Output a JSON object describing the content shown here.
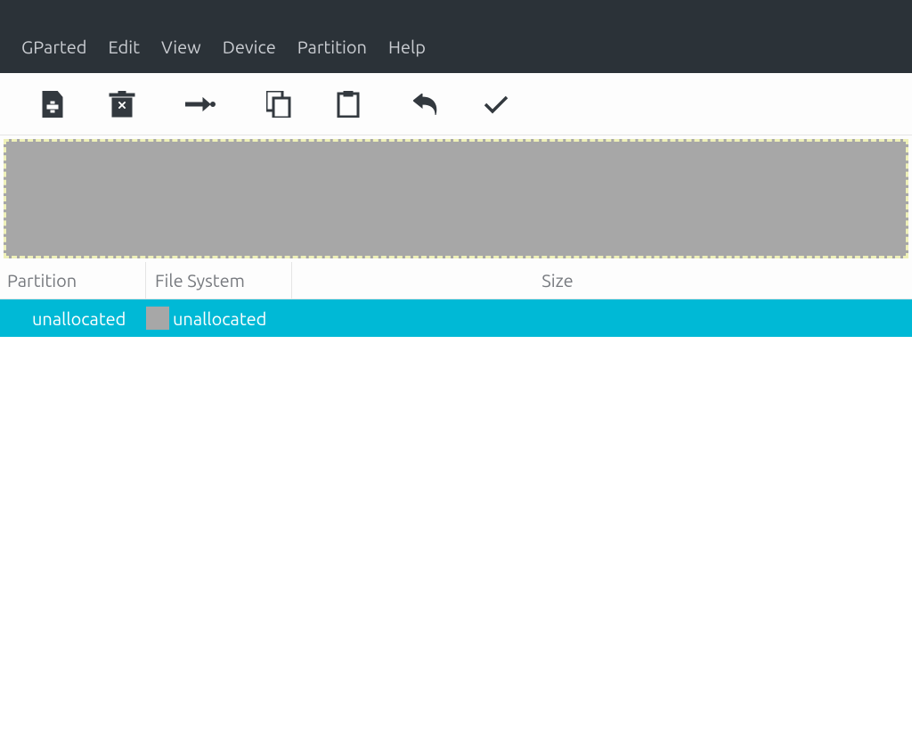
{
  "menubar": {
    "items": [
      "GParted",
      "Edit",
      "View",
      "Device",
      "Partition",
      "Help"
    ]
  },
  "toolbar": {
    "buttons": [
      "new-partition",
      "delete",
      "resize-move",
      "copy",
      "paste",
      "undo",
      "apply"
    ]
  },
  "table": {
    "headers": {
      "partition": "Partition",
      "filesystem": "File System",
      "size": "Size"
    },
    "rows": [
      {
        "partition": "unallocated",
        "filesystem": "unallocated",
        "fs_color": "#a7a7a7",
        "size": ""
      }
    ]
  }
}
